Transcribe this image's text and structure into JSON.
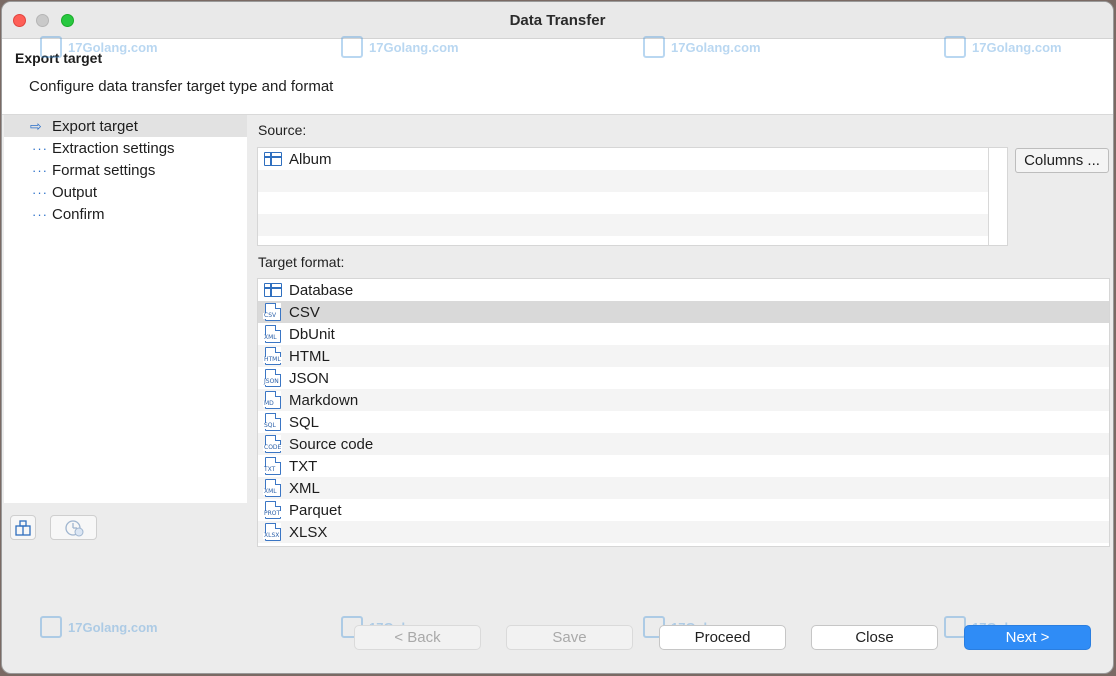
{
  "window": {
    "title": "Data Transfer"
  },
  "header": {
    "title": "Export target",
    "description": "Configure data transfer target type and format"
  },
  "watermark": {
    "text": "17Golang.com"
  },
  "nav": {
    "items": [
      {
        "label": "Export target",
        "active": true
      },
      {
        "label": "Extraction settings"
      },
      {
        "label": "Format settings"
      },
      {
        "label": "Output"
      },
      {
        "label": "Confirm"
      }
    ]
  },
  "source": {
    "label": "Source:",
    "rows": [
      {
        "label": "Album",
        "icon": "table-icon"
      }
    ],
    "columns_button": "Columns ..."
  },
  "target": {
    "label": "Target format:",
    "selected": "CSV",
    "formats": [
      {
        "label": "Database",
        "icon": "table-icon",
        "badge": ""
      },
      {
        "label": "CSV",
        "icon": "csv-file-icon",
        "badge": "CSV"
      },
      {
        "label": "DbUnit",
        "icon": "xml-file-icon",
        "badge": "XML"
      },
      {
        "label": "HTML",
        "icon": "html-file-icon",
        "badge": "HTML"
      },
      {
        "label": "JSON",
        "icon": "json-file-icon",
        "badge": "JSON"
      },
      {
        "label": "Markdown",
        "icon": "md-file-icon",
        "badge": "MD"
      },
      {
        "label": "SQL",
        "icon": "sql-file-icon",
        "badge": "SQL"
      },
      {
        "label": "Source code",
        "icon": "code-file-icon",
        "badge": "CODE"
      },
      {
        "label": "TXT",
        "icon": "txt-file-icon",
        "badge": "TXT"
      },
      {
        "label": "XML",
        "icon": "xml-file-icon",
        "badge": "XML"
      },
      {
        "label": "Parquet",
        "icon": "parquet-file-icon",
        "badge": "PROT"
      },
      {
        "label": "XLSX",
        "icon": "xlsx-file-icon",
        "badge": "XLSX"
      }
    ]
  },
  "footer": {
    "back": "< Back",
    "save": "Save",
    "proceed": "Proceed",
    "close": "Close",
    "next": "Next >"
  },
  "colors": {
    "accent": "#2f8cf6",
    "icon": "#2f6fbf"
  }
}
